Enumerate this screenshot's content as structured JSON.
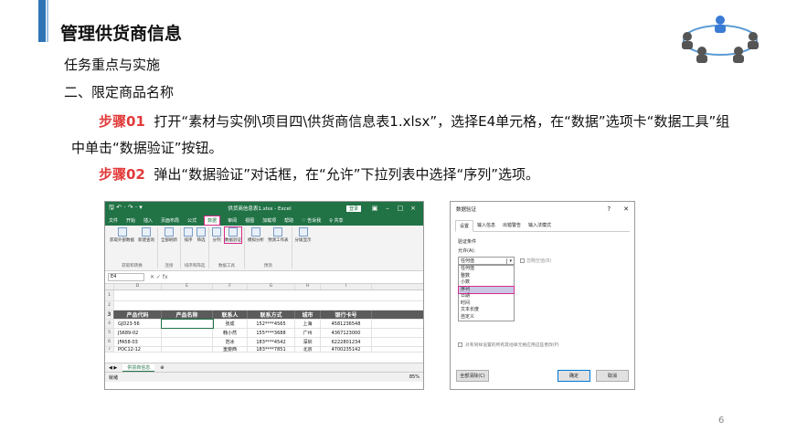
{
  "slide": {
    "title": "管理供货商信息",
    "subtitle": "任务重点与实施",
    "section": "二、限定商品名称",
    "step1_label": "步骤01",
    "step1_text": "打开“素材与实例\\项目四\\供货商信息表1.xlsx”，选择E4单元格，在“数据”选项卡“数据工具”组中单击“数据验证”按钮。",
    "step2_label": "步骤02",
    "step2_text": "弹出“数据验证”对话框，在“允许”下拉列表中选择“序列”选项。",
    "page_number": "6"
  },
  "excel": {
    "quick_access": "🖫 ↶ · ↷ · ▾",
    "file_title": "供货商信息表1.xlsx - Excel",
    "login": "登录",
    "tabs": [
      "文件",
      "开始",
      "插入",
      "页面布局",
      "公式",
      "数据",
      "审阅",
      "视图",
      "加载项",
      "帮助",
      "♡ 告诉我",
      "♀ 共享"
    ],
    "ribbon_groups": [
      {
        "label": "获取和转换",
        "buttons": [
          "获取外部数据",
          "新建查询"
        ]
      },
      {
        "label": "连接",
        "buttons": [
          "全部刷新"
        ]
      },
      {
        "label": "排序和筛选",
        "buttons": [
          "排序",
          "筛选"
        ]
      },
      {
        "label": "数据工具",
        "buttons": [
          "分列",
          "数据验证"
        ]
      },
      {
        "label": "预测",
        "buttons": [
          "模拟分析",
          "预测工作表"
        ]
      },
      {
        "label": "",
        "buttons": [
          "分级显示"
        ]
      }
    ],
    "name_box": "E4",
    "fx": "✕ ✓ fx",
    "columns": [
      "",
      "D",
      "E",
      "F",
      "G",
      "H",
      "I"
    ],
    "row_numbers": [
      "1",
      "2",
      "3",
      "4",
      "5",
      "6",
      "7"
    ],
    "header_row": [
      "产品代码",
      "产品名称",
      "联系人",
      "联系方式",
      "城市",
      "银行卡号"
    ],
    "rows": [
      [
        "GJD23-56",
        "",
        "张成",
        "152****4565",
        "上海",
        "4581236548"
      ],
      [
        "JS689-02",
        "",
        "韩小然",
        "155****3688",
        "广州",
        "4367123000"
      ],
      [
        "JFA58-03",
        "",
        "范冰",
        "183****4542",
        "深圳",
        "6222801234"
      ],
      [
        "POC12-12",
        "",
        "重要西",
        "183****7851",
        "北京",
        "4700235142"
      ]
    ],
    "sheet_tab": "供货商信息",
    "status": "就绪",
    "zoom": "85%"
  },
  "dialog": {
    "title": "数据验证",
    "help": "?",
    "close": "✕",
    "tabs": [
      "设置",
      "输入信息",
      "出错警告",
      "输入法模式"
    ],
    "criteria_label": "验证条件",
    "allow_label": "允许(A):",
    "allow_value": "任何值",
    "ignore_blank": "忽略空值(B)",
    "options": [
      "任何值",
      "整数",
      "小数",
      "序列",
      "日期",
      "时间",
      "文本长度",
      "自定义"
    ],
    "selected_option": "序列",
    "apply_all": "对有同样设置的所有其他单元格应用这些更改(P)",
    "clear_all": "全部清除(C)",
    "ok": "确定",
    "cancel": "取消"
  }
}
